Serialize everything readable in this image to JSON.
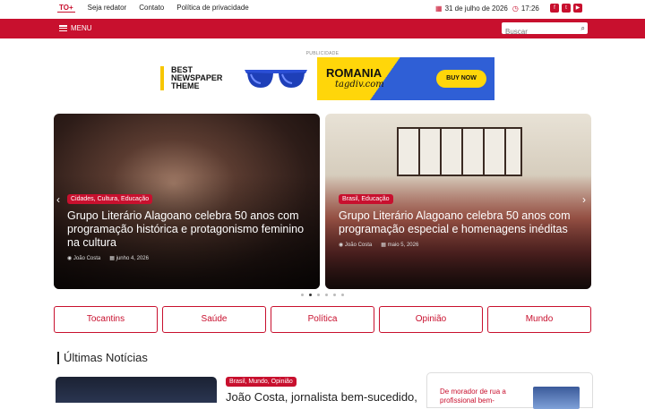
{
  "topbar": {
    "links": [
      "TO+",
      "Seja redator",
      "Contato",
      "Política de privacidade"
    ],
    "date": "31 de julho de 2026",
    "time": "17:26",
    "socials": [
      "facebook-icon",
      "twitter-icon",
      "youtube-icon"
    ]
  },
  "navbar": {
    "menu_label": "MENU",
    "search_placeholder": "Buscar"
  },
  "ad": {
    "label": "PUBLICIDADE",
    "line1": "BEST",
    "line2": "NEWSPAPER",
    "line3": "THEME",
    "romania": "ROMANIA",
    "tagdiv": "tagdiv.com",
    "buy": "BUY NOW"
  },
  "slider": {
    "slides": [
      {
        "cats": "Cidades, Cultura, Educação",
        "title": "Grupo Literário Alagoano celebra 50 anos com programação histórica e protagonismo feminino na cultura",
        "author": "João Costa",
        "date": "junho 4, 2026"
      },
      {
        "cats": "Brasil, Educação",
        "title": "Grupo Literário Alagoano celebra 50 anos com programação especial e homenagens inéditas",
        "author": "João Costa",
        "date": "maio 5, 2026"
      }
    ],
    "dots_count": 6,
    "active_dot": 1
  },
  "categories": [
    "Tocantins",
    "Saúde",
    "Política",
    "Opinião",
    "Mundo"
  ],
  "latest": {
    "section_title": "Últimas Notícias",
    "first_cats": "Brasil, Mundo, Opinião",
    "first_title": "João Costa, jornalista bem-sucedido,",
    "side_title": "De morador de rua a profissional bem-"
  },
  "colors": {
    "brand": "#c8102e"
  }
}
